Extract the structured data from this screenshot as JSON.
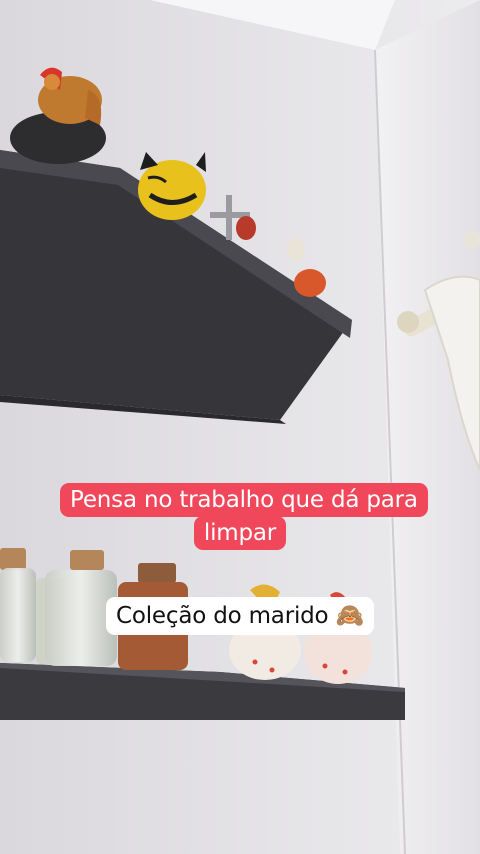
{
  "colors": {
    "caption_red": "#f0475b",
    "caption_white": "#ffffff",
    "wall": "#e9e7ea",
    "shelf": "#3c3b40"
  },
  "captions": {
    "main": "Pensa no trabalho que dá para limpar",
    "secondary": "Coleção do marido 🙈"
  }
}
